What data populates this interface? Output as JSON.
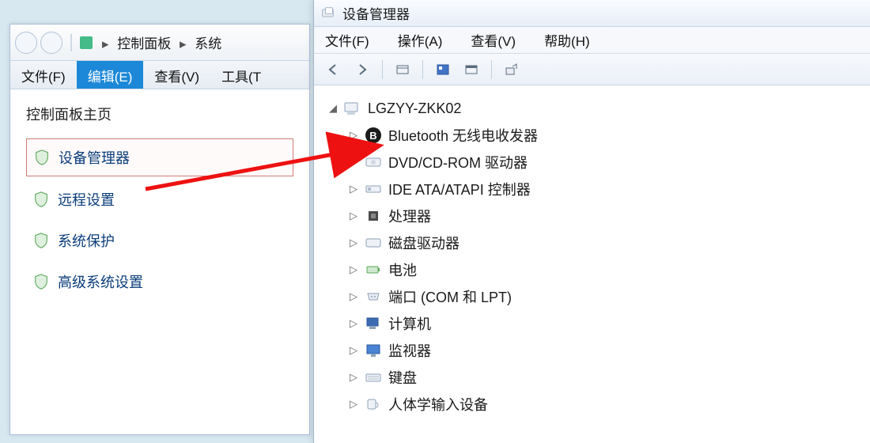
{
  "cp": {
    "breadcrumb": {
      "item1": "控制面板",
      "item2": "系统"
    },
    "menu": {
      "file": "文件(F)",
      "edit": "编辑(E)",
      "view": "查看(V)",
      "tools": "工具(T"
    },
    "heading": "控制面板主页",
    "links": {
      "device_manager": "设备管理器",
      "remote_settings": "远程设置",
      "system_protection": "系统保护",
      "advanced_system_settings": "高级系统设置"
    }
  },
  "dm": {
    "title": "设备管理器",
    "menu": {
      "file": "文件(F)",
      "action": "操作(A)",
      "view": "查看(V)",
      "help": "帮助(H)"
    },
    "root": "LGZYY-ZKK02",
    "nodes": {
      "bluetooth": "Bluetooth 无线电收发器",
      "dvd": "DVD/CD-ROM 驱动器",
      "ide": "IDE ATA/ATAPI 控制器",
      "cpu": "处理器",
      "disk": "磁盘驱动器",
      "battery": "电池",
      "ports": "端口 (COM 和 LPT)",
      "computer": "计算机",
      "monitor": "监视器",
      "keyboard": "键盘",
      "hid": "人体学输入设备"
    }
  }
}
